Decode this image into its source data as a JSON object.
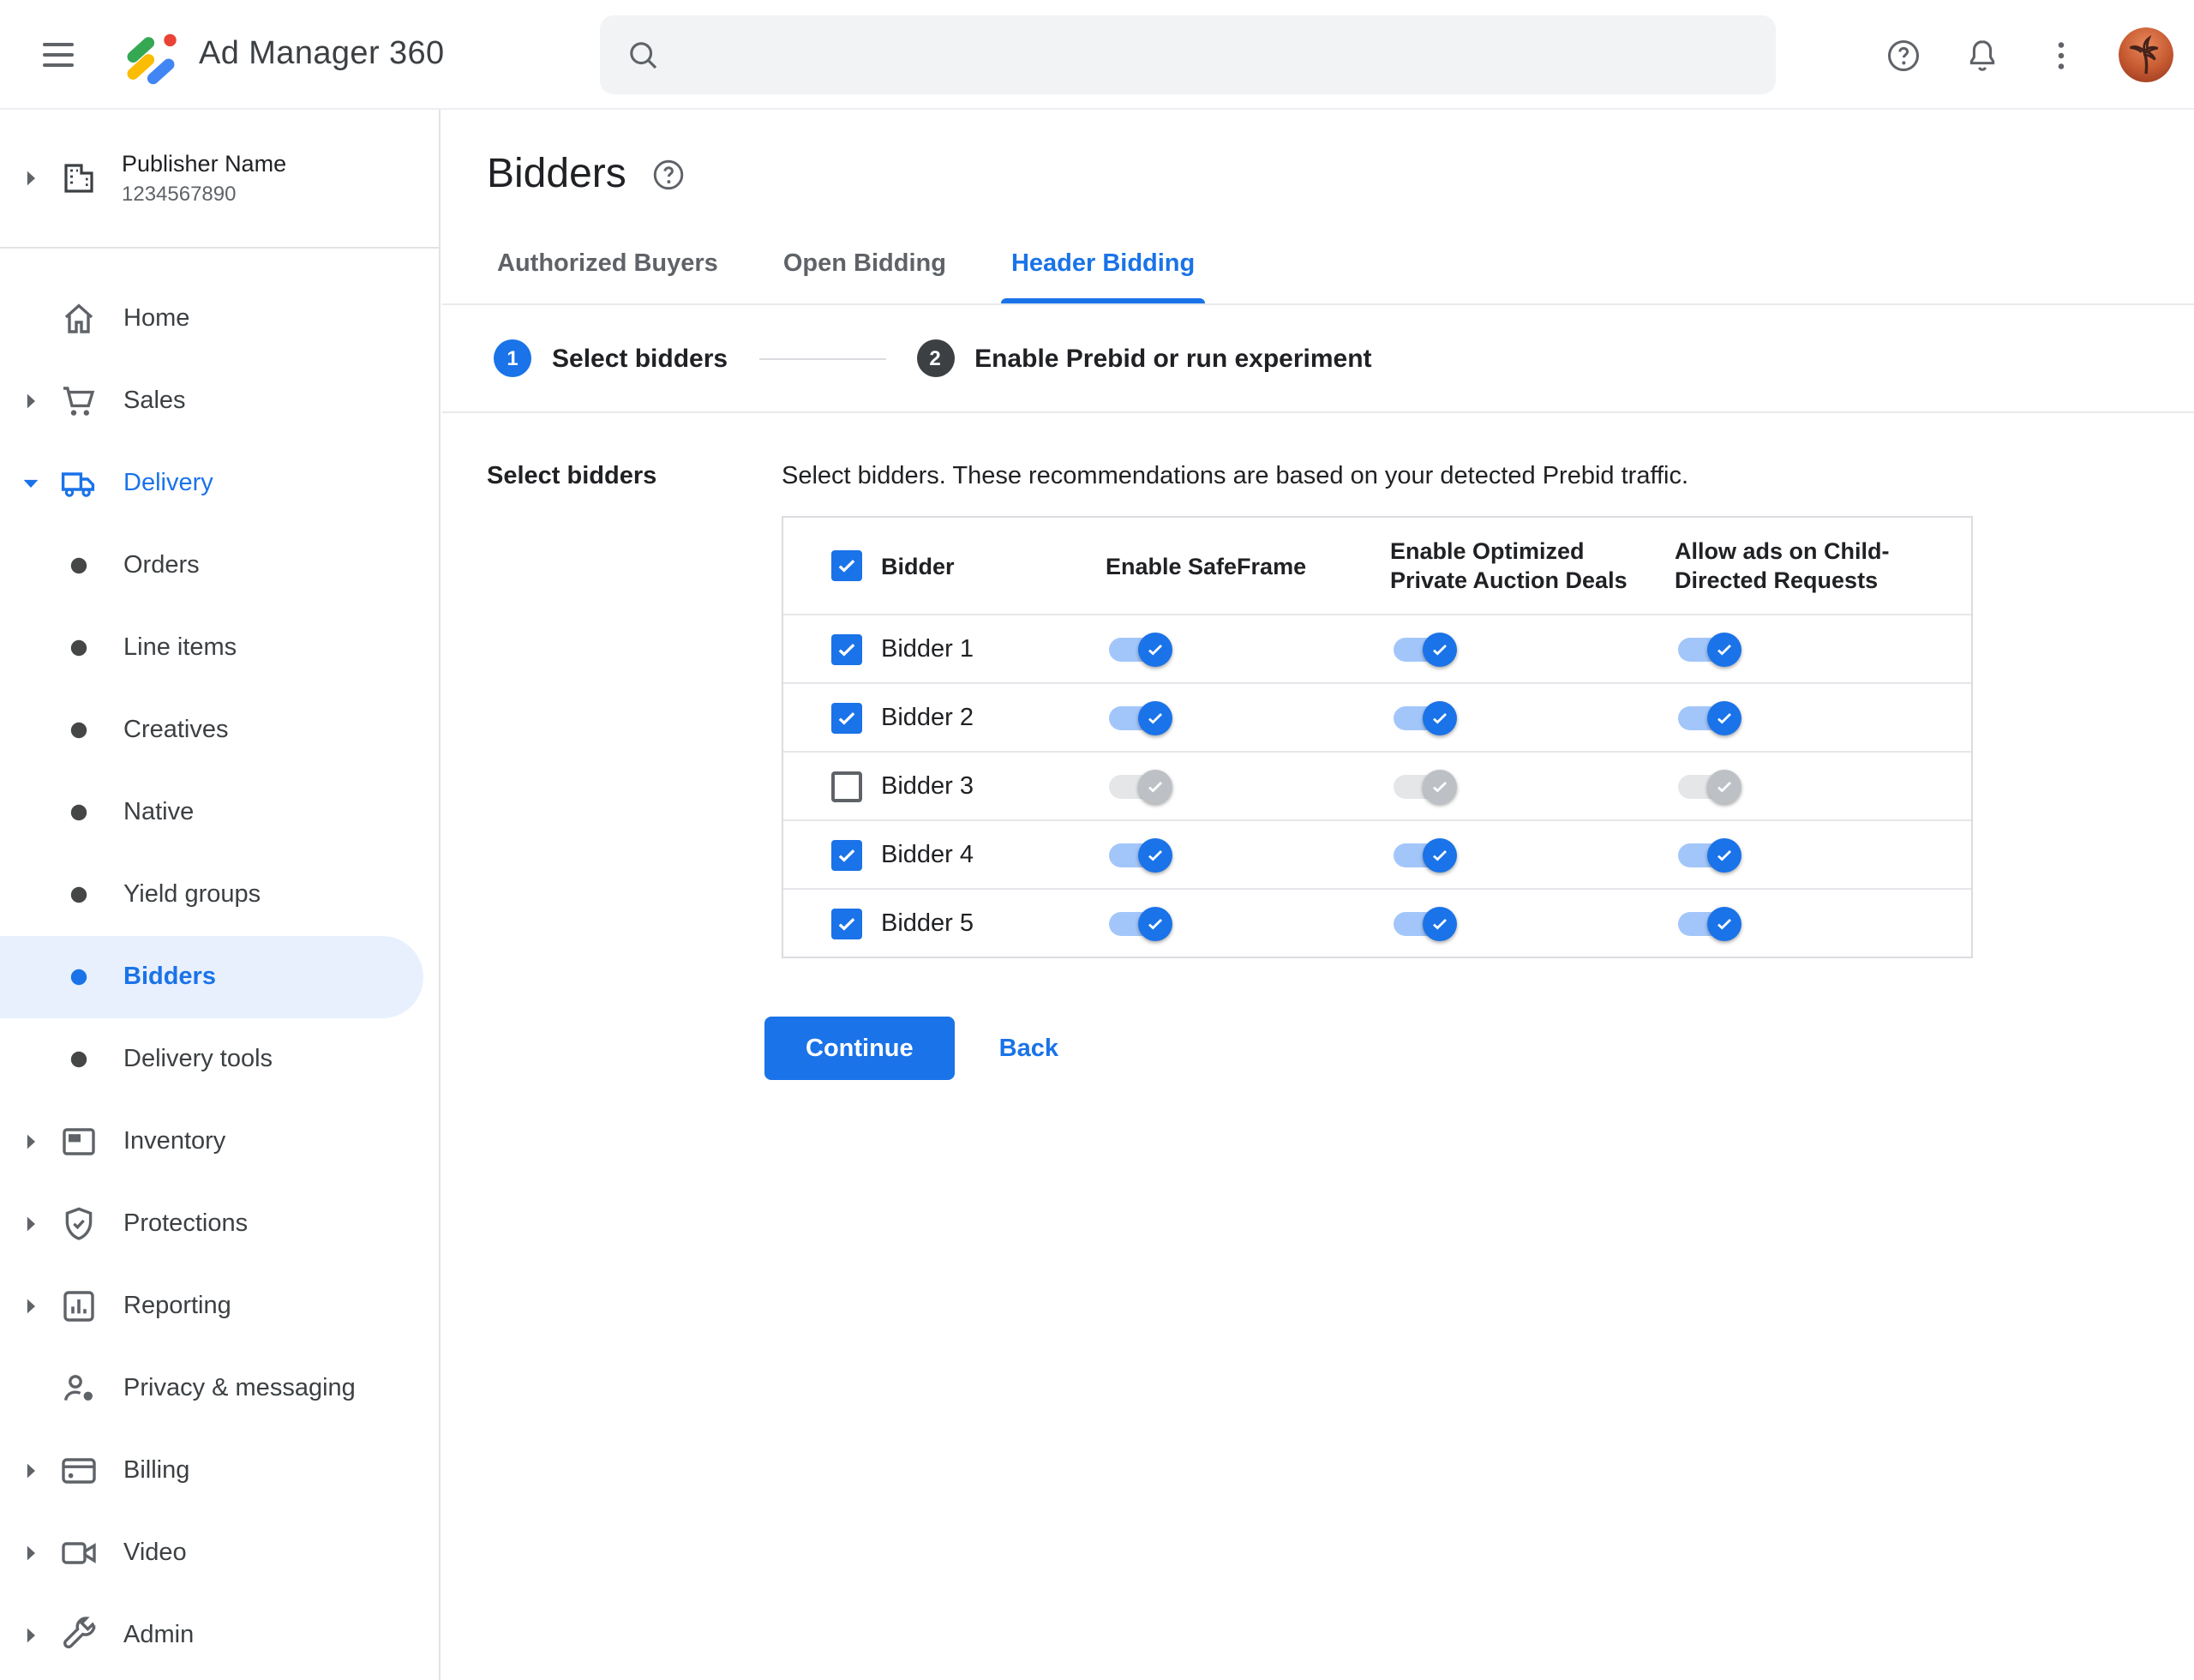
{
  "topbar": {
    "app_name": "Ad Manager 360",
    "search_value": "",
    "icons": [
      "menu-icon",
      "ad-manager-logo",
      "search-icon",
      "help-icon",
      "notifications-bell-icon",
      "overflow-kebab-icon",
      "avatar-palm-tree"
    ]
  },
  "sidebar": {
    "publisher": {
      "name": "Publisher Name",
      "id": "1234567890"
    },
    "nav": [
      {
        "label": "Home",
        "icon": "home",
        "indent": "top",
        "chevron": null,
        "active": false,
        "accent": false
      },
      {
        "label": "Sales",
        "icon": "cart",
        "indent": "top",
        "chevron": "right",
        "active": false,
        "accent": false
      },
      {
        "label": "Delivery",
        "icon": "truck",
        "indent": "top",
        "chevron": "down",
        "active": false,
        "accent": true
      },
      {
        "label": "Orders",
        "icon": "bullet",
        "indent": "sub",
        "chevron": null,
        "active": false,
        "accent": false
      },
      {
        "label": "Line items",
        "icon": "bullet",
        "indent": "sub",
        "chevron": null,
        "active": false,
        "accent": false
      },
      {
        "label": "Creatives",
        "icon": "bullet",
        "indent": "sub",
        "chevron": null,
        "active": false,
        "accent": false
      },
      {
        "label": "Native",
        "icon": "bullet",
        "indent": "sub",
        "chevron": null,
        "active": false,
        "accent": false
      },
      {
        "label": "Yield groups",
        "icon": "bullet",
        "indent": "sub",
        "chevron": null,
        "active": false,
        "accent": false
      },
      {
        "label": "Bidders",
        "icon": "bullet",
        "indent": "sub",
        "chevron": null,
        "active": true,
        "accent": false
      },
      {
        "label": "Delivery tools",
        "icon": "bullet",
        "indent": "sub",
        "chevron": null,
        "active": false,
        "accent": false
      },
      {
        "label": "Inventory",
        "icon": "window",
        "indent": "top",
        "chevron": "right",
        "active": false,
        "accent": false
      },
      {
        "label": "Protections",
        "icon": "shield",
        "indent": "top",
        "chevron": "right",
        "active": false,
        "accent": false
      },
      {
        "label": "Reporting",
        "icon": "chart",
        "indent": "top",
        "chevron": "right",
        "active": false,
        "accent": false
      },
      {
        "label": "Privacy & messaging",
        "icon": "person",
        "indent": "top",
        "chevron": null,
        "active": false,
        "accent": false
      },
      {
        "label": "Billing",
        "icon": "card",
        "indent": "top",
        "chevron": "right",
        "active": false,
        "accent": false
      },
      {
        "label": "Video",
        "icon": "camera",
        "indent": "top",
        "chevron": "right",
        "active": false,
        "accent": false
      },
      {
        "label": "Admin",
        "icon": "wrench",
        "indent": "top",
        "chevron": "right",
        "active": false,
        "accent": false
      }
    ]
  },
  "main": {
    "title": "Bidders",
    "tabs": [
      {
        "label": "Authorized Buyers",
        "active": false
      },
      {
        "label": "Open Bidding",
        "active": false
      },
      {
        "label": "Header Bidding",
        "active": true
      }
    ],
    "stepper": [
      {
        "number": "1",
        "label": "Select bidders",
        "state": "current"
      },
      {
        "number": "2",
        "label": "Enable Prebid or run experiment",
        "state": "upcoming"
      }
    ],
    "section_label": "Select bidders",
    "description": "Select bidders. These recommendations are based on your detected Prebid traffic.",
    "table": {
      "header_checkbox_checked": true,
      "headers": [
        "Bidder",
        "Enable SafeFrame",
        "Enable Optimized Private Auction Deals",
        "Allow ads on Child-Directed Requests"
      ],
      "rows": [
        {
          "name": "Bidder 1",
          "checked": true,
          "enable_safeframe": true,
          "enable_optimized_private_auction_deals": true,
          "allow_ads_child_directed": true
        },
        {
          "name": "Bidder 2",
          "checked": true,
          "enable_safeframe": true,
          "enable_optimized_private_auction_deals": true,
          "allow_ads_child_directed": true
        },
        {
          "name": "Bidder 3",
          "checked": false,
          "enable_safeframe": false,
          "enable_optimized_private_auction_deals": false,
          "allow_ads_child_directed": false
        },
        {
          "name": "Bidder 4",
          "checked": true,
          "enable_safeframe": true,
          "enable_optimized_private_auction_deals": true,
          "allow_ads_child_directed": true
        },
        {
          "name": "Bidder 5",
          "checked": true,
          "enable_safeframe": true,
          "enable_optimized_private_auction_deals": true,
          "allow_ads_child_directed": true
        }
      ]
    },
    "actions": {
      "continue_label": "Continue",
      "back_label": "Back"
    }
  },
  "colors": {
    "accent": "#1a73e8",
    "active_nav_bg": "#e8f0fe",
    "toggle_on_track": "#a3c6fa",
    "toggle_on_thumb": "#1a73e8",
    "toggle_off_track": "#e4e6e8",
    "toggle_off_thumb": "#bdc1c6",
    "text_primary": "#202124",
    "text_secondary": "#5f6368",
    "searchbar_bg": "#f1f3f4"
  }
}
